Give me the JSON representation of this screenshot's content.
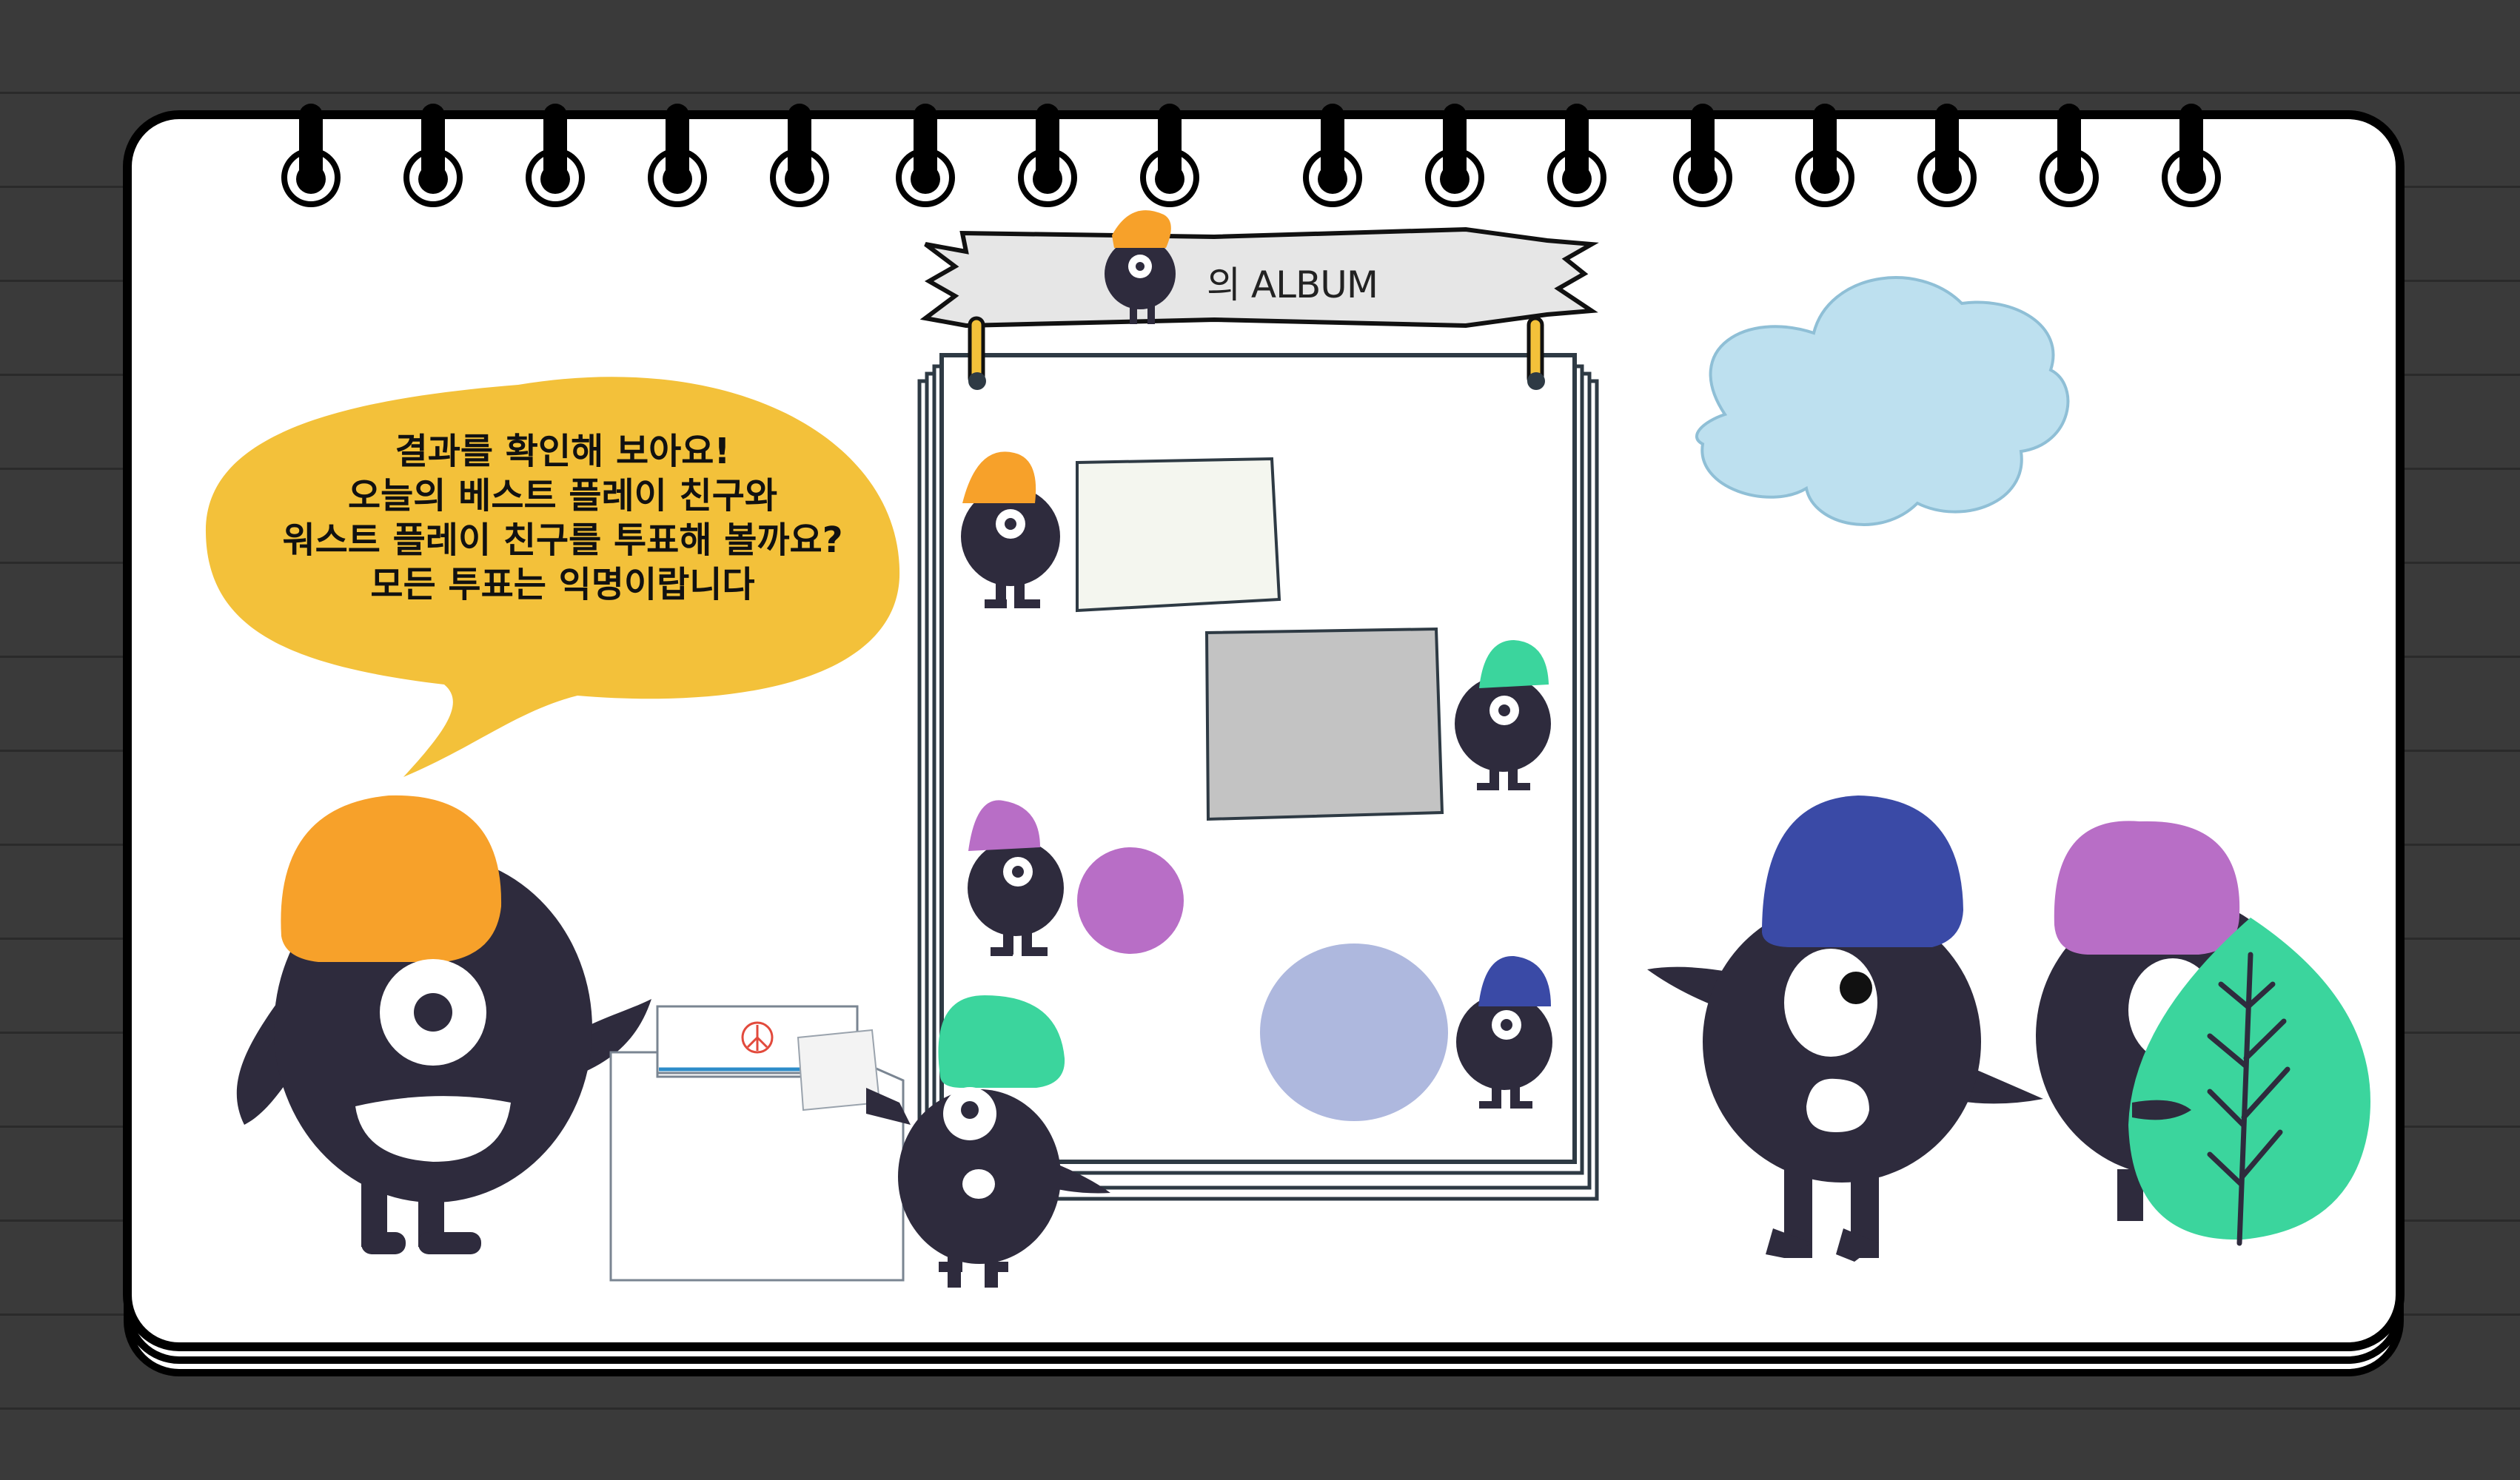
{
  "album": {
    "title": "의 ALBUM"
  },
  "speech": {
    "lines": [
      "결과를 확인해 보아요!",
      "오늘의 베스트 플레이 친구와",
      "워스트 플레이 친구를 투표해 볼까요?",
      "모든 투표는 익명이랍니다"
    ]
  },
  "colors": {
    "background": "#3a3a3a",
    "speech_bubble": "#f3c13a",
    "character_body": "#2e2b3d",
    "orange_hat": "#f7a12a",
    "green_hat": "#3bd59d",
    "purple_hat": "#b86ec6",
    "blue_hat": "#3a4aa6",
    "cloud": "#bde0ef",
    "leaf": "#3bd59d"
  }
}
